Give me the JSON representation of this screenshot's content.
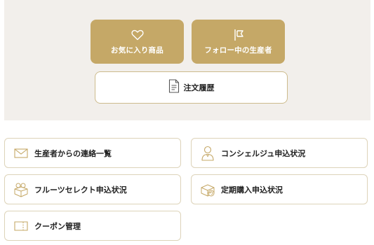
{
  "top": {
    "favorites": {
      "label": "お気に入り商品",
      "icon": "heart-icon"
    },
    "following": {
      "label": "フォロー中の生産者",
      "icon": "flag-icon"
    },
    "order_history": {
      "label": "注文履歴",
      "icon": "document-icon"
    }
  },
  "menu": {
    "messages": {
      "label": "生産者からの連絡一覧",
      "icon": "envelope-icon"
    },
    "concierge": {
      "label": "コンシェルジュ申込状況",
      "icon": "concierge-icon"
    },
    "fruit_select": {
      "label": "フルーツセレクト申込状況",
      "icon": "fruit-box-icon"
    },
    "subscription": {
      "label": "定期購入申込状況",
      "icon": "subscription-box-icon"
    },
    "coupons": {
      "label": "クーポン管理",
      "icon": "coupon-icon"
    }
  },
  "colors": {
    "gold": "#c5a867",
    "panel_bg": "#f2efeb",
    "border": "#ddd3b9"
  }
}
